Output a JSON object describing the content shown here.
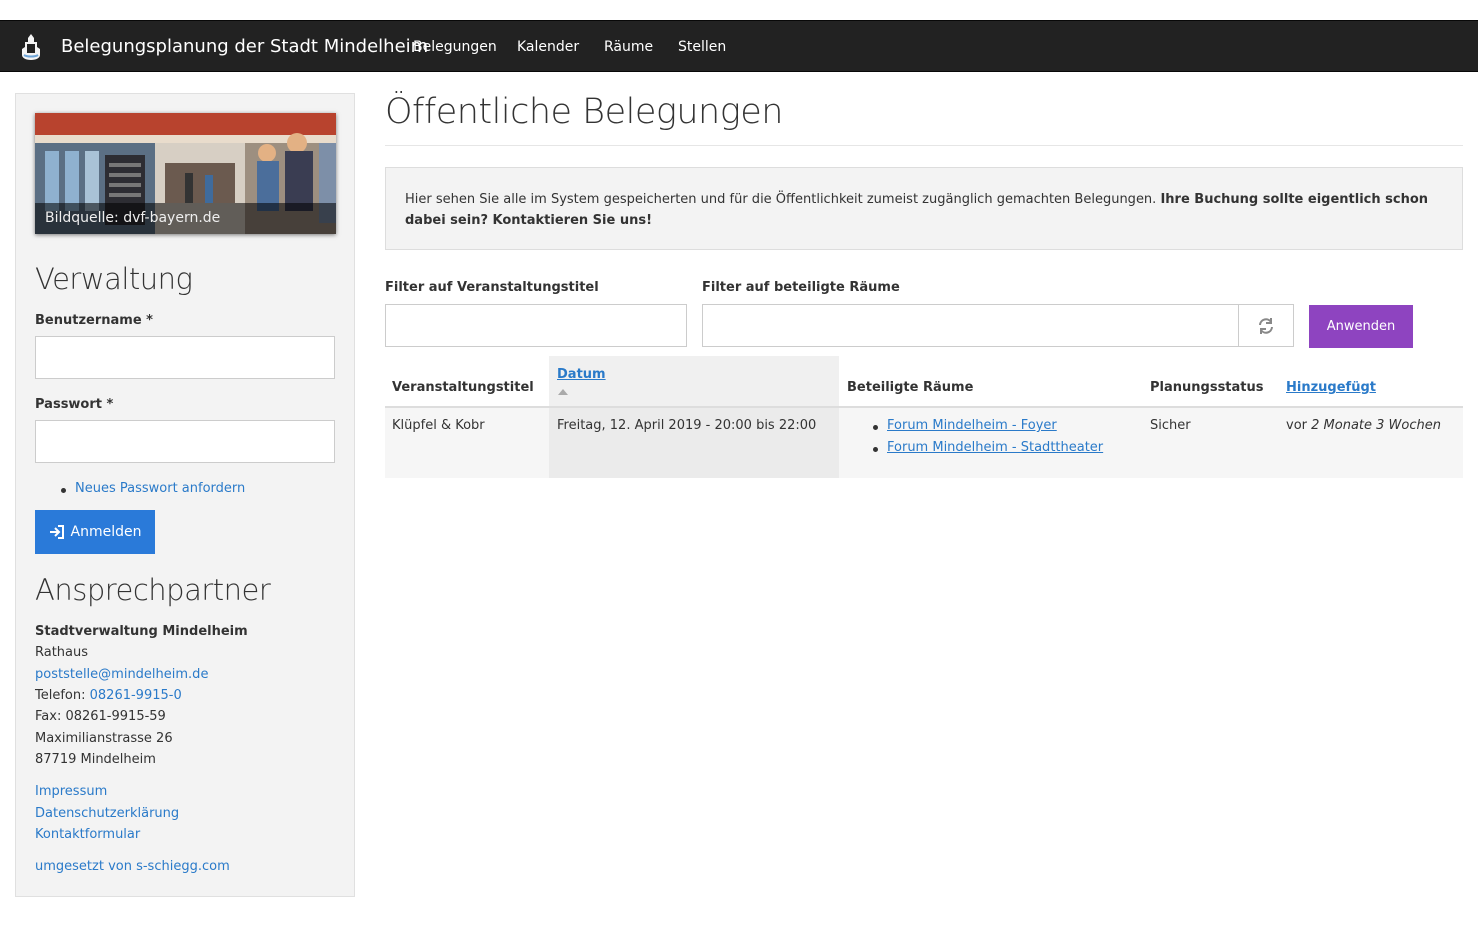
{
  "navbar": {
    "brand": "Belegungsplanung der Stadt Mindelheim",
    "items": [
      {
        "label": "Belegungen"
      },
      {
        "label": "Kalender"
      },
      {
        "label": "Räume"
      },
      {
        "label": "Stellen"
      }
    ],
    "logo_icon": "city-crest-icon",
    "background": "#222222"
  },
  "sidebar": {
    "image_caption": "Bildquelle: dvf-bayern.de",
    "admin_heading": "Verwaltung",
    "username_label": "Benutzername *",
    "username_value": "",
    "password_label": "Passwort *",
    "password_value": "",
    "forgot_password": "Neues Passwort anfordern",
    "login_button": "Anmelden",
    "login_icon": "sign-in-icon",
    "contact_heading": "Ansprechpartner",
    "contact": {
      "org": "Stadtverwaltung Mindelheim",
      "building": "Rathaus",
      "email": "poststelle@mindelheim.de",
      "phone_label": "Telefon: ",
      "phone": "08261-9915-0",
      "fax": "Fax: 08261-9915-59",
      "street": "Maximilianstrasse 26",
      "city": "87719 Mindelheim"
    },
    "links": [
      "Impressum",
      "Datenschutzerklärung",
      "Kontaktformular"
    ],
    "credit": "umgesetzt von s-schiegg.com"
  },
  "main": {
    "title": "Öffentliche Belegungen",
    "info_text": "Hier sehen Sie alle im System gespeicherten und für die Öffentlichkeit zumeist zugänglich gemachten Belegungen. ",
    "info_bold": "Ihre Buchung sollte eigentlich schon dabei sein? Kontaktieren Sie uns!",
    "filter_title_label": "Filter auf Veranstaltungstitel",
    "filter_title_value": "",
    "filter_rooms_label": "Filter auf beteiligte Räume",
    "filter_rooms_value": "",
    "reset_icon": "refresh-icon",
    "apply_button": "Anwenden",
    "apply_color": "#8e44c0",
    "table": {
      "headers": {
        "title": "Veranstaltungstitel",
        "date": "Datum",
        "rooms": "Beteiligte Räume",
        "status": "Planungsstatus",
        "added": "Hinzugefügt"
      },
      "rows": [
        {
          "title": "Klüpfel & Kobr",
          "date": "Freitag, 12. April 2019 - 20:00 bis 22:00",
          "rooms": [
            "Forum Mindelheim - Foyer",
            "Forum Mindelheim - Stadttheater"
          ],
          "status": "Sicher",
          "added_prefix": "vor ",
          "added_value": "2 Monate 3 Wochen"
        }
      ]
    }
  }
}
